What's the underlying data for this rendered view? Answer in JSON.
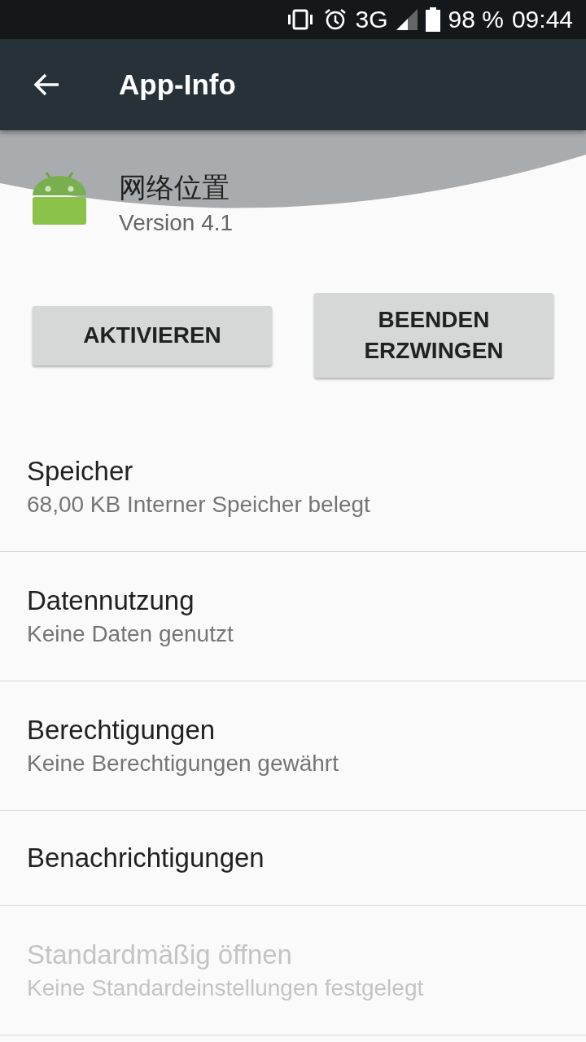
{
  "status_bar": {
    "battery": "98 %",
    "time": "09:44",
    "network": "3G"
  },
  "toolbar": {
    "title": "App-Info"
  },
  "app": {
    "name": "网络位置",
    "version": "Version 4.1"
  },
  "buttons": [
    "AKTIVIEREN",
    "BEENDEN ERZWINGEN"
  ],
  "items": [
    {
      "title": "Speicher",
      "summary": "68,00 KB Interner Speicher belegt",
      "disabled": false
    },
    {
      "title": "Datennutzung",
      "summary": "Keine Daten genutzt",
      "disabled": false
    },
    {
      "title": "Berechtigungen",
      "summary": "Keine Berechtigungen gewährt",
      "disabled": false
    },
    {
      "title": "Benachrichtigungen",
      "disabled": false
    },
    {
      "title": "Standardmäßig öffnen",
      "summary": "Keine Standardeinstellungen festgelegt",
      "disabled": true
    }
  ]
}
